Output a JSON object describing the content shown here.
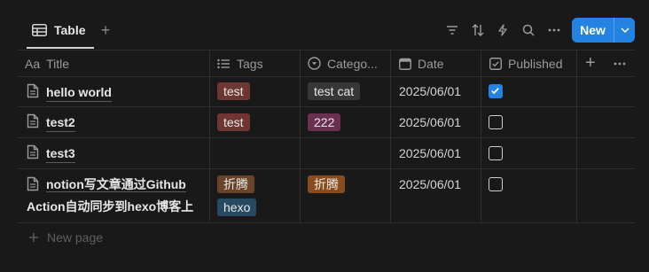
{
  "toolbar": {
    "view_label": "Table",
    "new_label": "New"
  },
  "columns": [
    {
      "prefix": "Aa",
      "label": "Title",
      "icon": "text-icon"
    },
    {
      "prefix": "",
      "label": "Tags",
      "icon": "list-icon"
    },
    {
      "prefix": "",
      "label": "Catego...",
      "icon": "select-icon"
    },
    {
      "prefix": "",
      "label": "Date",
      "icon": "calendar-icon"
    },
    {
      "prefix": "",
      "label": "Published",
      "icon": "checkbox-icon"
    }
  ],
  "rows": [
    {
      "title_lines": [
        "hello world"
      ],
      "tags": [
        {
          "label": "test",
          "color": "#6e3630"
        }
      ],
      "category": {
        "label": "test cat",
        "color": "#373737"
      },
      "date": "2025/06/01",
      "published": true
    },
    {
      "title_lines": [
        "test2"
      ],
      "tags": [
        {
          "label": "test",
          "color": "#6e3630"
        }
      ],
      "category": {
        "label": "222",
        "color": "#6a3050"
      },
      "date": "2025/06/01",
      "published": false
    },
    {
      "title_lines": [
        "test3"
      ],
      "tags": [],
      "category": null,
      "date": "2025/06/01",
      "published": false
    },
    {
      "title_lines": [
        "notion写文章通过Github",
        "Action自动同步到hexo博客上"
      ],
      "tags": [
        {
          "label": "折腾",
          "color": "#6b4329"
        },
        {
          "label": "hexo",
          "color": "#274a63"
        }
      ],
      "category": {
        "label": "折腾",
        "color": "#8a4c1c"
      },
      "date": "2025/06/01",
      "published": false
    }
  ],
  "footer": {
    "new_page_label": "New page"
  },
  "colors": {
    "background": "#191919",
    "accent": "#2383e2",
    "grid": "#2f2f2f"
  }
}
